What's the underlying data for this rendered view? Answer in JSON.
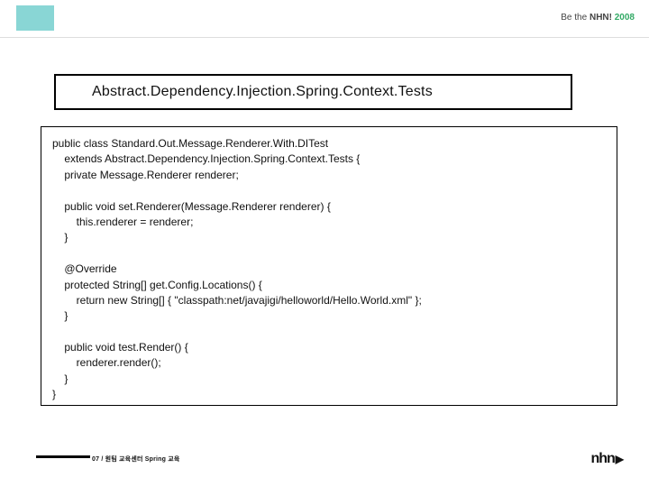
{
  "header": {
    "tagline_prefix": "Be the ",
    "tagline_brand": "NHN!",
    "tagline_year": " 2008"
  },
  "title": "Abstract.Dependency.Injection.Spring.Context.Tests",
  "code": "public class Standard.Out.Message.Renderer.With.DITest\n    extends Abstract.Dependency.Injection.Spring.Context.Tests {\n    private Message.Renderer renderer;\n\n    public void set.Renderer(Message.Renderer renderer) {\n        this.renderer = renderer;\n    }\n\n    @Override\n    protected String[] get.Config.Locations() {\n        return new String[] { \"classpath:net/javajigi/helloworld/Hello.World.xml\" };\n    }\n\n    public void test.Render() {\n        renderer.render();\n    }\n}",
  "footer": {
    "caption": "07 / 원팀 교육센터 Spring 교육"
  },
  "logo": {
    "text": "nhn",
    "arrow": "▶"
  }
}
